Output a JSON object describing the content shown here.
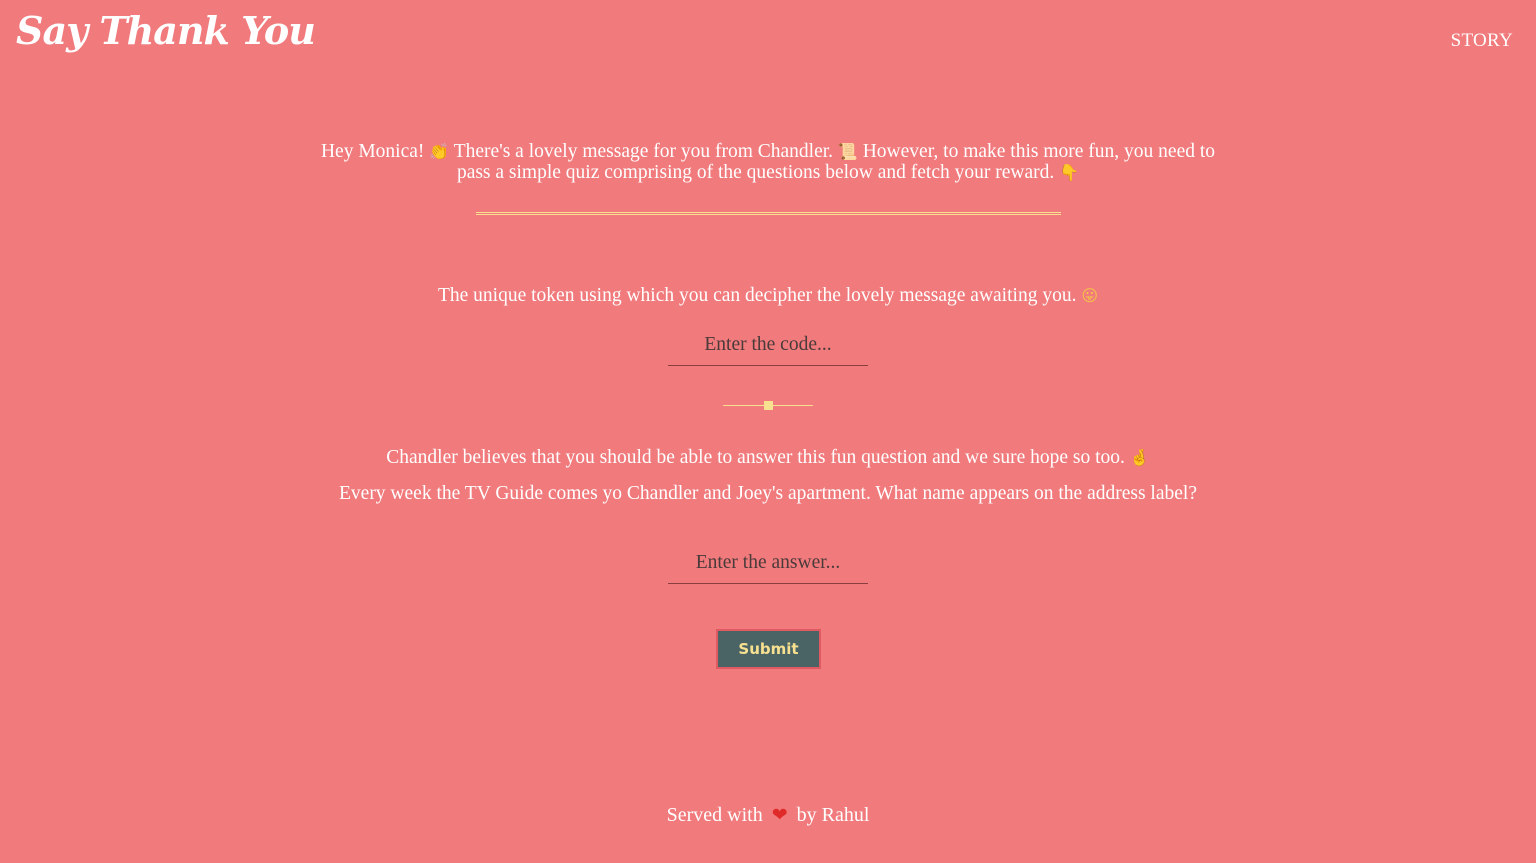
{
  "header": {
    "brand": "Say Thank You",
    "nav_story": "STORY"
  },
  "intro": {
    "part1": "Hey Monica! ",
    "emoji1": "👏",
    "part2": " There's a lovely message for you from Chandler. ",
    "emoji2": "📜",
    "part3": " However, to make this more fun, you need to pass a simple quiz comprising of the questions below and fetch your reward. ",
    "emoji3": "👇"
  },
  "question1": {
    "text": "The unique token using which you can decipher the lovely message awaiting you. ",
    "emoji": "😛",
    "input_value": "",
    "placeholder": "Enter the code..."
  },
  "question2": {
    "intro": "Chandler believes that you should be able to answer this fun question and we sure hope so too. ",
    "intro_emoji": "🤞",
    "text": "Every week the TV Guide comes yo Chandler and Joey's apartment. What name appears on the address label?",
    "input_value": "",
    "placeholder": "Enter the answer..."
  },
  "submit_label": "Submit",
  "footer": {
    "before": "Served with",
    "heart": "❤",
    "after": "by Rahul"
  },
  "colors": {
    "background": "#f07a7c",
    "accent": "#f7e08f",
    "button_bg": "#4a6466"
  }
}
